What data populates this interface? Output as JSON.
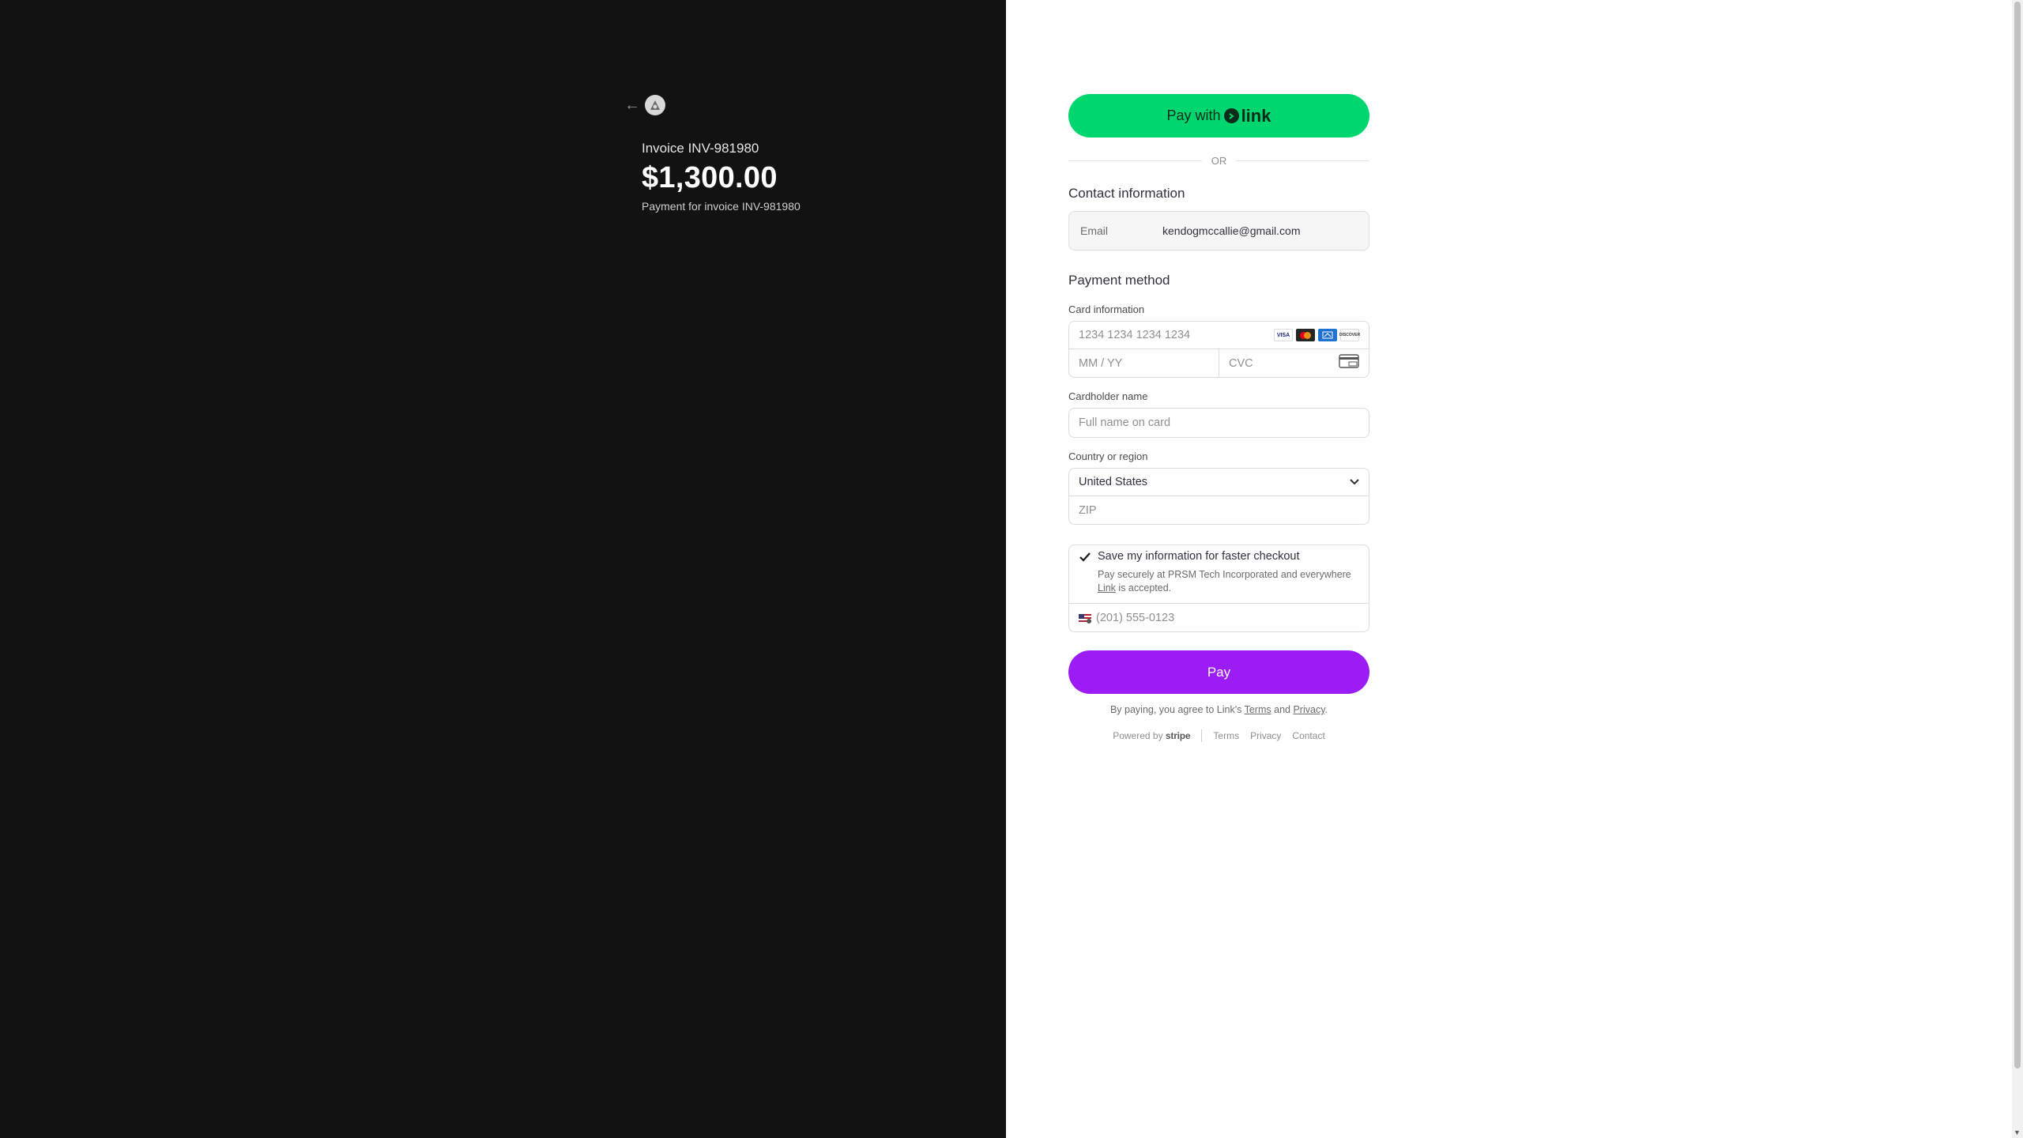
{
  "invoice": {
    "title": "Invoice INV-981980",
    "amount": "$1,300.00",
    "description": "Payment for invoice INV-981980"
  },
  "link_button": {
    "prefix": "Pay with",
    "brand": "link"
  },
  "divider_text": "OR",
  "contact": {
    "title": "Contact information",
    "email_label": "Email",
    "email_value": "kendogmccallie@gmail.com"
  },
  "payment": {
    "title": "Payment method",
    "card_label": "Card information",
    "card_number_placeholder": "1234 1234 1234 1234",
    "expiry_placeholder": "MM / YY",
    "cvc_placeholder": "CVC",
    "card_brands": [
      "visa-icon",
      "mastercard-icon",
      "amex-icon",
      "discover-icon"
    ],
    "brand_visa_text": "VISA",
    "brand_discover_text": "DISCOVER",
    "cardholder_label": "Cardholder name",
    "cardholder_placeholder": "Full name on card",
    "country_label": "Country or region",
    "country_value": "United States",
    "zip_placeholder": "ZIP"
  },
  "save_info": {
    "checked": true,
    "title": "Save my information for faster checkout",
    "desc_before": "Pay securely at PRSM Tech Incorporated and everywhere",
    "desc_link": "Link",
    "desc_after": "is accepted.",
    "phone_placeholder": "(201) 555-0123"
  },
  "pay_button": "Pay",
  "legal": {
    "before": "By paying, you agree to Link's",
    "terms": "Terms",
    "and": "and",
    "privacy": "Privacy",
    "period": "."
  },
  "footer": {
    "powered_by": "Powered by",
    "stripe": "stripe",
    "terms": "Terms",
    "privacy": "Privacy",
    "contact": "Contact"
  },
  "colors": {
    "left_panel": "#121212",
    "link_green": "#00d66f",
    "pay_purple": "#9b1cf5"
  }
}
